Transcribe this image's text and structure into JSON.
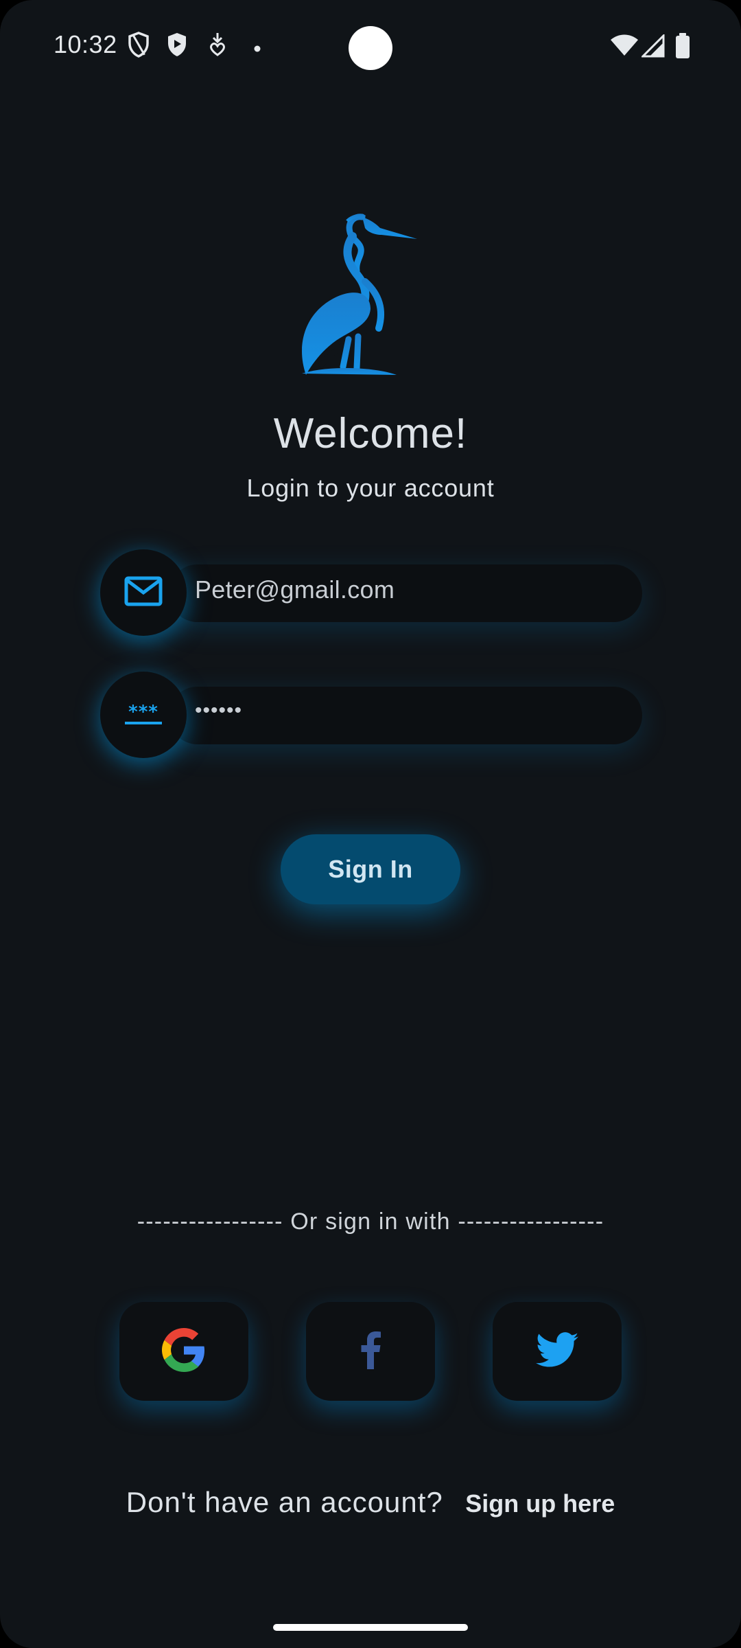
{
  "status_bar": {
    "time": "10:32",
    "icons": [
      "shield-outline-icon",
      "shield-play-icon",
      "download-heart-icon",
      "dot-icon",
      "wifi-icon",
      "signal-icon",
      "battery-icon"
    ]
  },
  "header": {
    "logo": "heron-logo",
    "title": "Welcome!",
    "subtitle": "Login to your account"
  },
  "form": {
    "email": {
      "icon": "mail-icon",
      "value": "Peter@gmail.com"
    },
    "password": {
      "icon": "password-icon",
      "value": "••••••"
    },
    "submit_label": "Sign In"
  },
  "social": {
    "divider_text": "----------------- Or sign in with -----------------",
    "providers": [
      "google-icon",
      "facebook-icon",
      "twitter-icon"
    ]
  },
  "footer": {
    "question": "Don't have an account?",
    "link_label": "Sign up here"
  },
  "colors": {
    "background": "#101418",
    "accent": "#1a8fd8",
    "button": "#044b6f"
  }
}
